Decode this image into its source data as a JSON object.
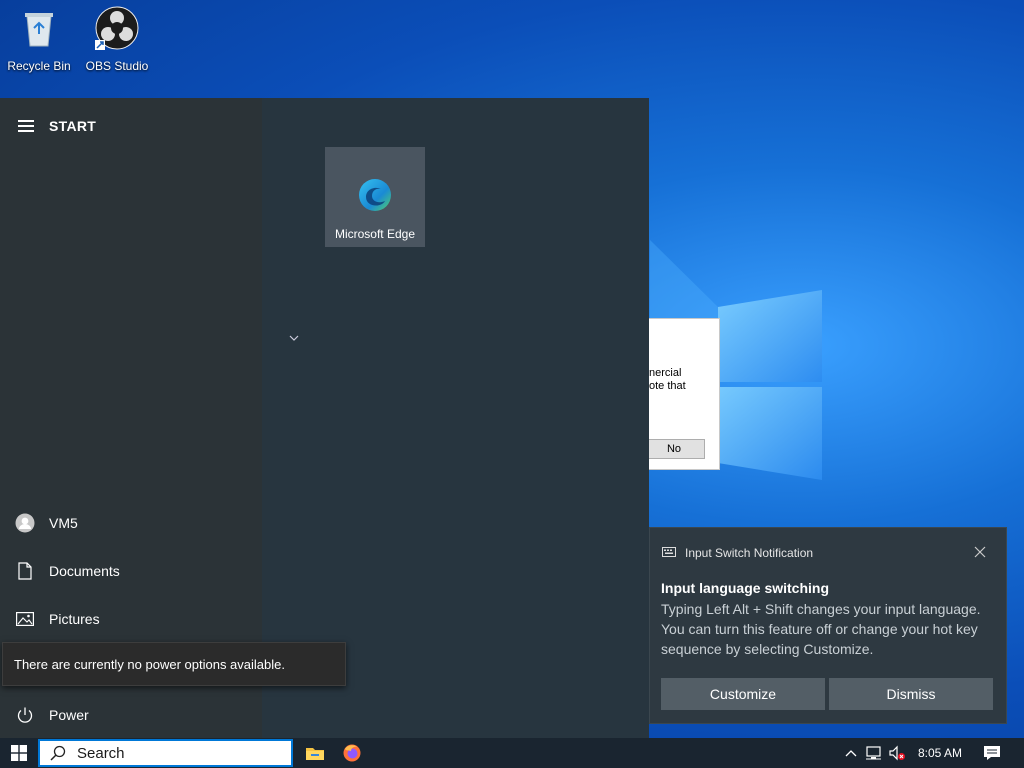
{
  "desktop": {
    "icons": [
      {
        "label": "Recycle Bin",
        "icon": "recycle-bin-icon"
      },
      {
        "label": "OBS Studio",
        "icon": "obs-studio-icon"
      }
    ],
    "background_dialog": {
      "text_line1": "nercial",
      "text_line2": "ote that",
      "no_button": "No"
    }
  },
  "start_menu": {
    "title": "START",
    "left_items": [
      {
        "label": "VM5",
        "icon": "user-avatar-icon"
      },
      {
        "label": "Documents",
        "icon": "document-icon"
      },
      {
        "label": "Pictures",
        "icon": "pictures-icon"
      },
      {
        "label": "Power",
        "icon": "power-icon"
      }
    ],
    "power_tooltip": "There are currently no power options available.",
    "tiles": [
      {
        "label": "Microsoft Edge",
        "icon": "edge-icon"
      }
    ]
  },
  "notification": {
    "app_name": "Input Switch Notification",
    "title": "Input language switching",
    "body": "Typing Left Alt + Shift changes your input language. You can turn this feature off or change your hot key sequence by selecting Customize.",
    "buttons": {
      "customize": "Customize",
      "dismiss": "Dismiss"
    }
  },
  "taskbar": {
    "search_placeholder": "Search",
    "pinned_apps": [
      "file-explorer-icon",
      "firefox-icon"
    ],
    "tray_icons": [
      "chevron-up-icon",
      "network-icon",
      "volume-muted-icon"
    ],
    "clock": "8:05 AM"
  },
  "colors": {
    "accent": "#0078d7",
    "start_bg": "#27353f",
    "toast_bg": "#2e3941",
    "taskbar_bg": "#1a2530"
  }
}
